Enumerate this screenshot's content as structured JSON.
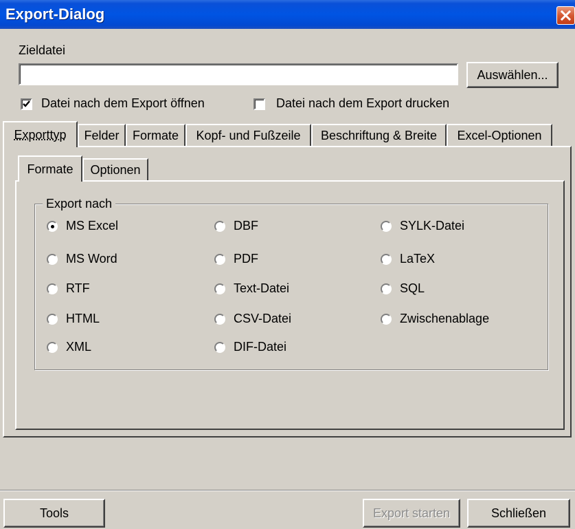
{
  "window": {
    "title": "Export-Dialog"
  },
  "target": {
    "label": "Zieldatei",
    "value": "",
    "browse_label": "Auswählen..."
  },
  "options": {
    "open_after": {
      "label": "Datei nach dem Export öffnen",
      "checked": true
    },
    "print_after": {
      "label": "Datei nach dem Export drucken",
      "checked": false
    }
  },
  "tabs": [
    {
      "label": "Exporttyp",
      "active": true
    },
    {
      "label": "Felder"
    },
    {
      "label": "Formate"
    },
    {
      "label": "Kopf- und Fußzeile"
    },
    {
      "label": "Beschriftung & Breite"
    },
    {
      "label": "Excel-Optionen"
    }
  ],
  "subtabs": [
    {
      "label": "Formate",
      "active": true
    },
    {
      "label": "Optionen"
    }
  ],
  "export_group": {
    "legend": "Export nach",
    "selected": "MS Excel",
    "options": [
      "MS Excel",
      "MS Word",
      "RTF",
      "HTML",
      "XML",
      "DBF",
      "PDF",
      "Text-Datei",
      "CSV-Datei",
      "DIF-Datei",
      "SYLK-Datei",
      "LaTeX",
      "SQL",
      "Zwischenablage"
    ]
  },
  "footer": {
    "tools_label": "Tools",
    "export_label": "Export starten",
    "close_label": "Schließen"
  }
}
